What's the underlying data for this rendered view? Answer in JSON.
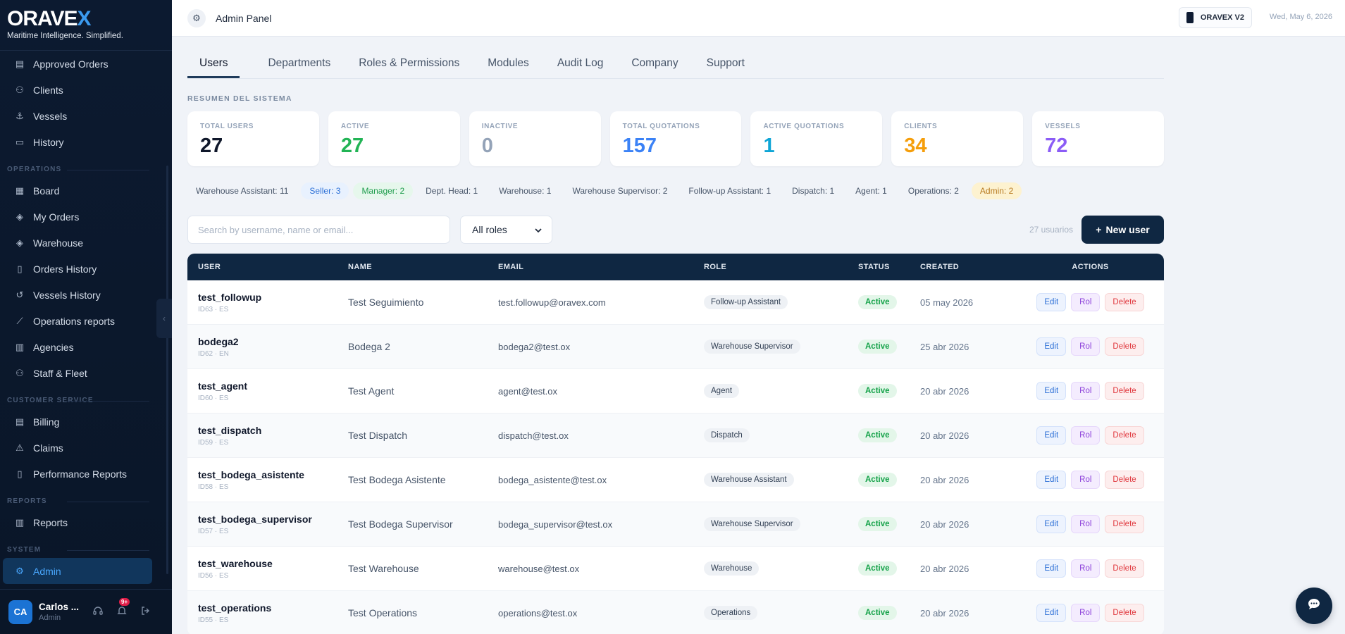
{
  "brand": {
    "name": "ORAVE",
    "name_accent": "X",
    "tagline": "Maritime Intelligence. Simplified."
  },
  "sidebar": {
    "items_top": [
      {
        "label": "Approved Orders",
        "icon": "list-icon"
      },
      {
        "label": "Clients",
        "icon": "users-icon"
      },
      {
        "label": "Vessels",
        "icon": "anchor-icon"
      },
      {
        "label": "History",
        "icon": "book-icon"
      }
    ],
    "sections": [
      {
        "title": "OPERATIONS",
        "items": [
          "Board",
          "My Orders",
          "Warehouse",
          "Orders History",
          "Vessels History",
          "Operations reports",
          "Agencies",
          "Staff & Fleet"
        ]
      },
      {
        "title": "CUSTOMER SERVICE",
        "items": [
          "Billing",
          "Claims",
          "Performance Reports"
        ]
      },
      {
        "title": "REPORTS",
        "items": [
          "Reports"
        ]
      },
      {
        "title": "SYSTEM",
        "items": [
          "Admin"
        ]
      }
    ],
    "user": {
      "initials": "CA",
      "name": "Carlos ...",
      "role": "Admin",
      "notifications": "9+"
    }
  },
  "topbar": {
    "title": "Admin Panel",
    "version": "ORAVEX V2",
    "date": "Wed, May 6, 2026"
  },
  "tabs": [
    "Users",
    "Departments",
    "Roles & Permissions",
    "Modules",
    "Audit Log",
    "Company",
    "Support"
  ],
  "summary": {
    "label": "RESUMEN DEL SISTEMA",
    "stats": [
      {
        "label": "TOTAL USERS",
        "value": "27",
        "color": "#0f172a"
      },
      {
        "label": "ACTIVE",
        "value": "27",
        "color": "#22b455"
      },
      {
        "label": "INACTIVE",
        "value": "0",
        "color": "#94a3b8"
      },
      {
        "label": "TOTAL QUOTATIONS",
        "value": "157",
        "color": "#3b82f6"
      },
      {
        "label": "ACTIVE QUOTATIONS",
        "value": "1",
        "color": "#0ea5d6"
      },
      {
        "label": "CLIENTS",
        "value": "34",
        "color": "#f59e0b"
      },
      {
        "label": "VESSELS",
        "value": "72",
        "color": "#8b5cf6"
      }
    ]
  },
  "role_pills": [
    {
      "text": "Warehouse Assistant: 11",
      "style": ""
    },
    {
      "text": "Seller: 3",
      "style": "seller"
    },
    {
      "text": "Manager: 2",
      "style": "manager"
    },
    {
      "text": "Dept. Head: 1",
      "style": ""
    },
    {
      "text": "Warehouse: 1",
      "style": ""
    },
    {
      "text": "Warehouse Supervisor: 2",
      "style": ""
    },
    {
      "text": "Follow-up Assistant: 1",
      "style": ""
    },
    {
      "text": "Dispatch: 1",
      "style": ""
    },
    {
      "text": "Agent: 1",
      "style": ""
    },
    {
      "text": "Operations: 2",
      "style": ""
    },
    {
      "text": "Admin: 2",
      "style": "admin"
    }
  ],
  "toolbar": {
    "search_placeholder": "Search by username, name or email...",
    "role_filter": "All roles",
    "count": "27 usuarios",
    "new_user": "New user"
  },
  "table": {
    "headers": [
      "USER",
      "NAME",
      "EMAIL",
      "ROLE",
      "STATUS",
      "CREATED",
      "ACTIONS"
    ],
    "actions": {
      "edit": "Edit",
      "rol": "Rol",
      "delete": "Delete"
    },
    "rows": [
      {
        "user": "test_followup",
        "id": "ID63 · ES",
        "name": "Test Seguimiento",
        "email": "test.followup@oravex.com",
        "role": "Follow-up Assistant",
        "status": "Active",
        "created": "05 may 2026"
      },
      {
        "user": "bodega2",
        "id": "ID62 · EN",
        "name": "Bodega 2",
        "email": "bodega2@test.ox",
        "role": "Warehouse Supervisor",
        "status": "Active",
        "created": "25 abr 2026"
      },
      {
        "user": "test_agent",
        "id": "ID60 · ES",
        "name": "Test Agent",
        "email": "agent@test.ox",
        "role": "Agent",
        "status": "Active",
        "created": "20 abr 2026"
      },
      {
        "user": "test_dispatch",
        "id": "ID59 · ES",
        "name": "Test Dispatch",
        "email": "dispatch@test.ox",
        "role": "Dispatch",
        "status": "Active",
        "created": "20 abr 2026"
      },
      {
        "user": "test_bodega_asistente",
        "id": "ID58 · ES",
        "name": "Test Bodega Asistente",
        "email": "bodega_asistente@test.ox",
        "role": "Warehouse Assistant",
        "status": "Active",
        "created": "20 abr 2026"
      },
      {
        "user": "test_bodega_supervisor",
        "id": "ID57 · ES",
        "name": "Test Bodega Supervisor",
        "email": "bodega_supervisor@test.ox",
        "role": "Warehouse Supervisor",
        "status": "Active",
        "created": "20 abr 2026"
      },
      {
        "user": "test_warehouse",
        "id": "ID56 · ES",
        "name": "Test Warehouse",
        "email": "warehouse@test.ox",
        "role": "Warehouse",
        "status": "Active",
        "created": "20 abr 2026"
      },
      {
        "user": "test_operations",
        "id": "ID55 · ES",
        "name": "Test Operations",
        "email": "operations@test.ox",
        "role": "Operations",
        "status": "Active",
        "created": "20 abr 2026"
      }
    ]
  }
}
